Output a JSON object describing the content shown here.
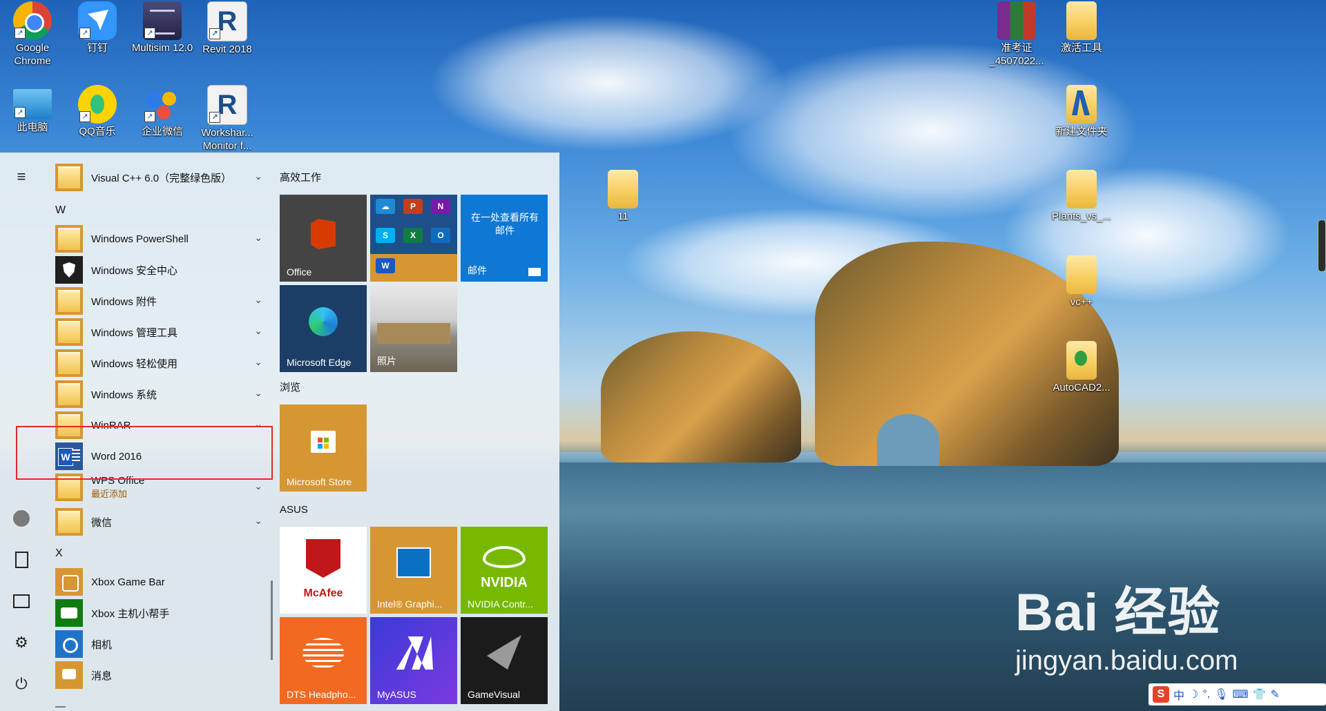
{
  "desktop": {
    "icons": [
      {
        "label": "Google Chrome",
        "icon": "chrome-icon"
      },
      {
        "label": "钉钉",
        "icon": "dingtalk-icon"
      },
      {
        "label": "Multisim 12.0",
        "icon": "multisim-icon"
      },
      {
        "label": "Revit 2018",
        "icon": "revit-icon"
      },
      {
        "label": "此电脑",
        "icon": "computer-icon"
      },
      {
        "label": "QQ音乐",
        "icon": "qqmusic-icon"
      },
      {
        "label": "企业微信",
        "icon": "wecom-icon"
      },
      {
        "label": "Workshar... Monitor f...",
        "icon": "worksharing-monitor-icon"
      },
      {
        "label": "准考证 _4507022...",
        "icon": "winrar-archive-icon"
      },
      {
        "label": "激活工具",
        "icon": "folder-icon"
      },
      {
        "label": "新建文件夹",
        "icon": "folder-icon"
      },
      {
        "label": "11",
        "icon": "folder-icon"
      },
      {
        "label": "Plants_vs_...",
        "icon": "folder-icon"
      },
      {
        "label": "vc++",
        "icon": "folder-icon"
      },
      {
        "label": "AutoCAD2...",
        "icon": "folder-icon"
      }
    ]
  },
  "start_menu": {
    "apps": [
      {
        "label": "Visual C++ 6.0（完整绿色版）",
        "icon": "folder-icon",
        "expandable": true
      },
      {
        "label": "W",
        "type": "letter"
      },
      {
        "label": "Windows PowerShell",
        "icon": "folder-icon",
        "expandable": true
      },
      {
        "label": "Windows 安全中心",
        "icon": "shield-icon",
        "expandable": false
      },
      {
        "label": "Windows 附件",
        "icon": "folder-icon",
        "expandable": true
      },
      {
        "label": "Windows 管理工具",
        "icon": "folder-icon",
        "expandable": true
      },
      {
        "label": "Windows 轻松使用",
        "icon": "folder-icon",
        "expandable": true
      },
      {
        "label": "Windows 系统",
        "icon": "folder-icon",
        "expandable": true
      },
      {
        "label": "WinRAR",
        "icon": "folder-icon",
        "expandable": true
      },
      {
        "label": "Word 2016",
        "icon": "word-icon",
        "expandable": false
      },
      {
        "label": "WPS Office",
        "sublabel": "最近添加",
        "icon": "folder-icon",
        "expandable": true
      },
      {
        "label": "微信",
        "icon": "folder-icon",
        "expandable": true
      },
      {
        "label": "X",
        "type": "letter"
      },
      {
        "label": "Xbox Game Bar",
        "icon": "xbox-game-bar-icon",
        "expandable": false
      },
      {
        "label": "Xbox 主机小帮手",
        "icon": "xbox-companion-icon",
        "expandable": false
      },
      {
        "label": "相机",
        "icon": "camera-icon",
        "expandable": false
      },
      {
        "label": "消息",
        "icon": "messaging-icon",
        "expandable": false
      }
    ],
    "groups": {
      "productivity": "高效工作",
      "browse": "浏览",
      "asus": "ASUS"
    },
    "tiles": {
      "office": "Office",
      "mail_headline": "在一处查看所有邮件",
      "mail": "邮件",
      "edge": "Microsoft Edge",
      "photos": "照片",
      "store": "Microsoft Store",
      "mcafee_brand": "McAfee",
      "intel": "Intel® Graphi...",
      "nvidia_brand": "NVIDIA",
      "nvidia": "NVIDIA Contr...",
      "dts": "DTS Headpho...",
      "myasus": "MyASUS",
      "gamevisual": "GameVisual"
    }
  },
  "watermark": {
    "brand": "Bai 经验",
    "url": "jingyan.baidu.com"
  },
  "ime_bar": {
    "logo": "S",
    "mode": "中"
  },
  "colors": {
    "highlight_box": "#e02a2a",
    "tile_orange": "#d69632",
    "tile_blue": "#0f78d4",
    "tile_dark": "#444444",
    "edge_tile": "#1c3d66"
  }
}
